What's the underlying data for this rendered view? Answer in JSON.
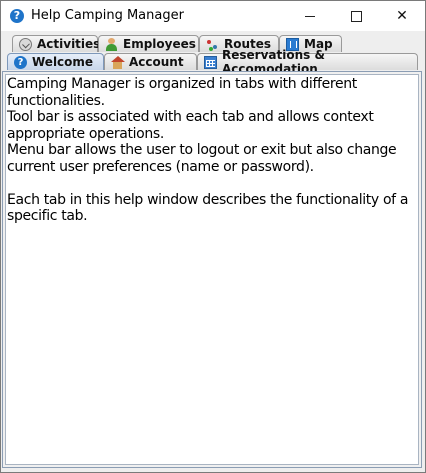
{
  "window": {
    "title": "Help Camping Manager",
    "icon": "help-icon",
    "controls": [
      "minimize",
      "maximize",
      "close"
    ]
  },
  "tabs_row1": [
    {
      "label": "Activities",
      "icon": "checkmark-circle-icon"
    },
    {
      "label": "Employees",
      "icon": "person-icon"
    },
    {
      "label": "Routes",
      "icon": "routes-icon"
    },
    {
      "label": "Map",
      "icon": "map-icon"
    }
  ],
  "tabs_row2": [
    {
      "label": "Welcome",
      "icon": "help-icon",
      "selected": true
    },
    {
      "label": "Account",
      "icon": "house-icon"
    },
    {
      "label": "Reservations & Accomodation",
      "icon": "calendar-icon"
    }
  ],
  "content": {
    "text": "Camping Manager is organized in tabs with different functionalities.\nTool bar is associated with each tab and allows context appropriate operations.\nMenu bar allows the user to logout or exit but also change current user preferences (name or password).\n\nEach tab in this help window describes the functionality of a specific tab."
  },
  "colors": {
    "selected_tab": "#c8d6ea",
    "panel_border": "#8b9db4",
    "accent": "#1f74c9"
  }
}
